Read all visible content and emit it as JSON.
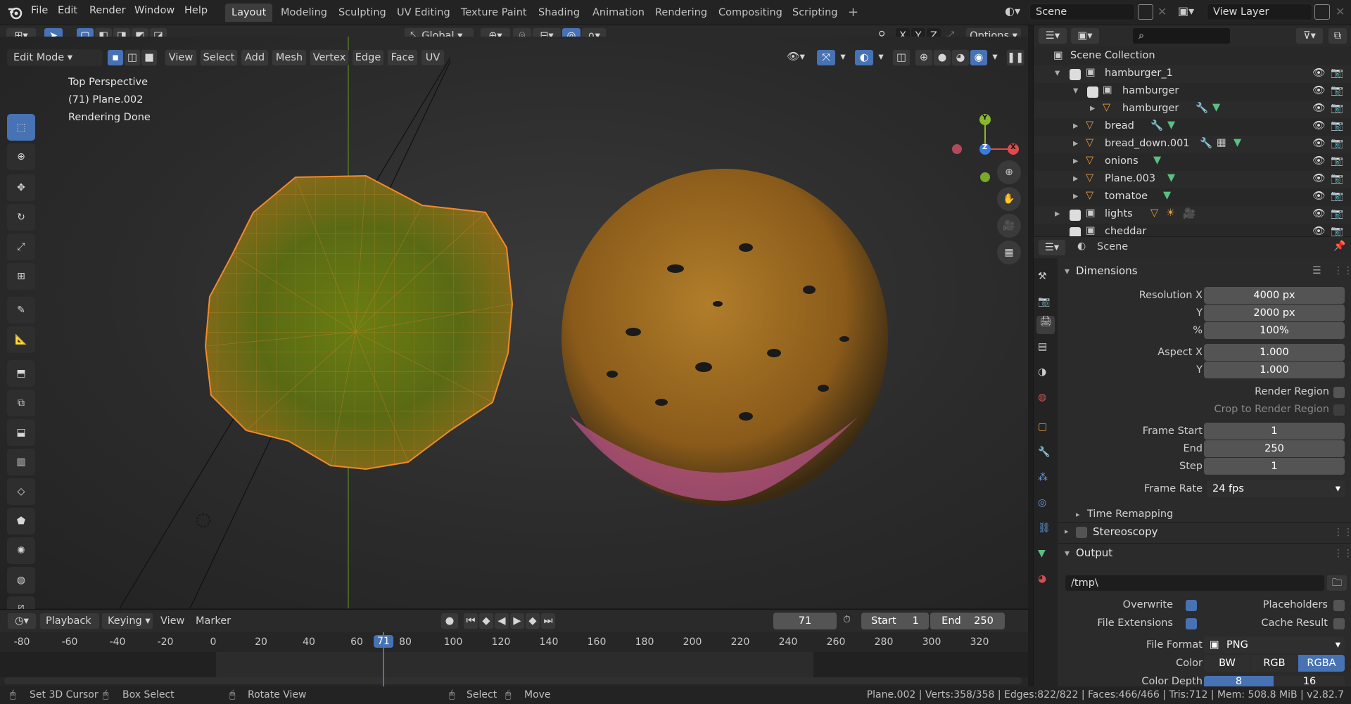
{
  "topbar": {
    "menus": [
      "File",
      "Edit",
      "Render",
      "Window",
      "Help"
    ],
    "workspaces": [
      "Layout",
      "Modeling",
      "Sculpting",
      "UV Editing",
      "Texture Paint",
      "Shading",
      "Animation",
      "Rendering",
      "Compositing",
      "Scripting"
    ],
    "add_tab": "+",
    "scene": "Scene",
    "view_layer": "View Layer"
  },
  "viewport_header": {
    "orientation": "Global",
    "axes": [
      "X",
      "Y",
      "Z"
    ],
    "options": "Options",
    "mode": "Edit Mode",
    "menus": [
      "View",
      "Select",
      "Add",
      "Mesh",
      "Vertex",
      "Edge",
      "Face",
      "UV"
    ]
  },
  "viewport": {
    "info_lines": [
      "Top Perspective",
      "(71) Plane.002",
      "Rendering Done"
    ],
    "gizmo": {
      "x": "X",
      "y": "Y",
      "z": "Z"
    }
  },
  "outliner": {
    "title": "Scene Collection",
    "rows": [
      {
        "name": "hamburger_1"
      },
      {
        "name": "hamburger"
      },
      {
        "name": "hamburger"
      },
      {
        "name": "bread"
      },
      {
        "name": "bread_down.001"
      },
      {
        "name": "onions"
      },
      {
        "name": "Plane.003"
      },
      {
        "name": "tomatoe"
      },
      {
        "name": "lights"
      },
      {
        "name": "cheddar"
      }
    ]
  },
  "properties": {
    "context": "Scene",
    "dimensions": {
      "title": "Dimensions",
      "resolution_x_label": "Resolution X",
      "resolution_x": "4000 px",
      "resolution_y_label": "Y",
      "resolution_y": "2000 px",
      "percent_label": "%",
      "percent": "100%",
      "aspect_x_label": "Aspect X",
      "aspect_x": "1.000",
      "aspect_y_label": "Y",
      "aspect_y": "1.000",
      "render_region": "Render Region",
      "crop": "Crop to Render Region",
      "frame_start_label": "Frame Start",
      "frame_start": "1",
      "end_label": "End",
      "end": "250",
      "step_label": "Step",
      "step": "1",
      "frame_rate_label": "Frame Rate",
      "frame_rate": "24 fps",
      "time_remapping": "Time Remapping"
    },
    "stereoscopy": "Stereoscopy",
    "output": {
      "title": "Output",
      "path": "/tmp\\",
      "overwrite": "Overwrite",
      "placeholders": "Placeholders",
      "file_extensions": "File Extensions",
      "cache_result": "Cache Result",
      "file_format_label": "File Format",
      "file_format": "PNG",
      "color_label": "Color",
      "color_modes": [
        "BW",
        "RGB",
        "RGBA"
      ],
      "color_depth_label": "Color Depth",
      "color_depths": [
        "8",
        "16"
      ]
    }
  },
  "timeline": {
    "menus": [
      "Playback",
      "Keying",
      "View",
      "Marker"
    ],
    "current_frame": "71",
    "start_label": "Start",
    "start": "1",
    "end_label": "End",
    "end": "250",
    "ticks": [
      "-80",
      "-60",
      "-40",
      "-20",
      "0",
      "20",
      "40",
      "60",
      "71",
      "80",
      "100",
      "120",
      "140",
      "160",
      "180",
      "200",
      "220",
      "240",
      "260",
      "280",
      "300",
      "320"
    ]
  },
  "statusbar": {
    "hints": [
      "Set 3D Cursor",
      "Box Select",
      "Rotate View",
      "Select",
      "Move"
    ],
    "stats": "Plane.002 | Verts:358/358 | Edges:822/822 | Faces:466/466 | Tris:712 | Mem: 508.8 MiB | v2.82.7"
  }
}
